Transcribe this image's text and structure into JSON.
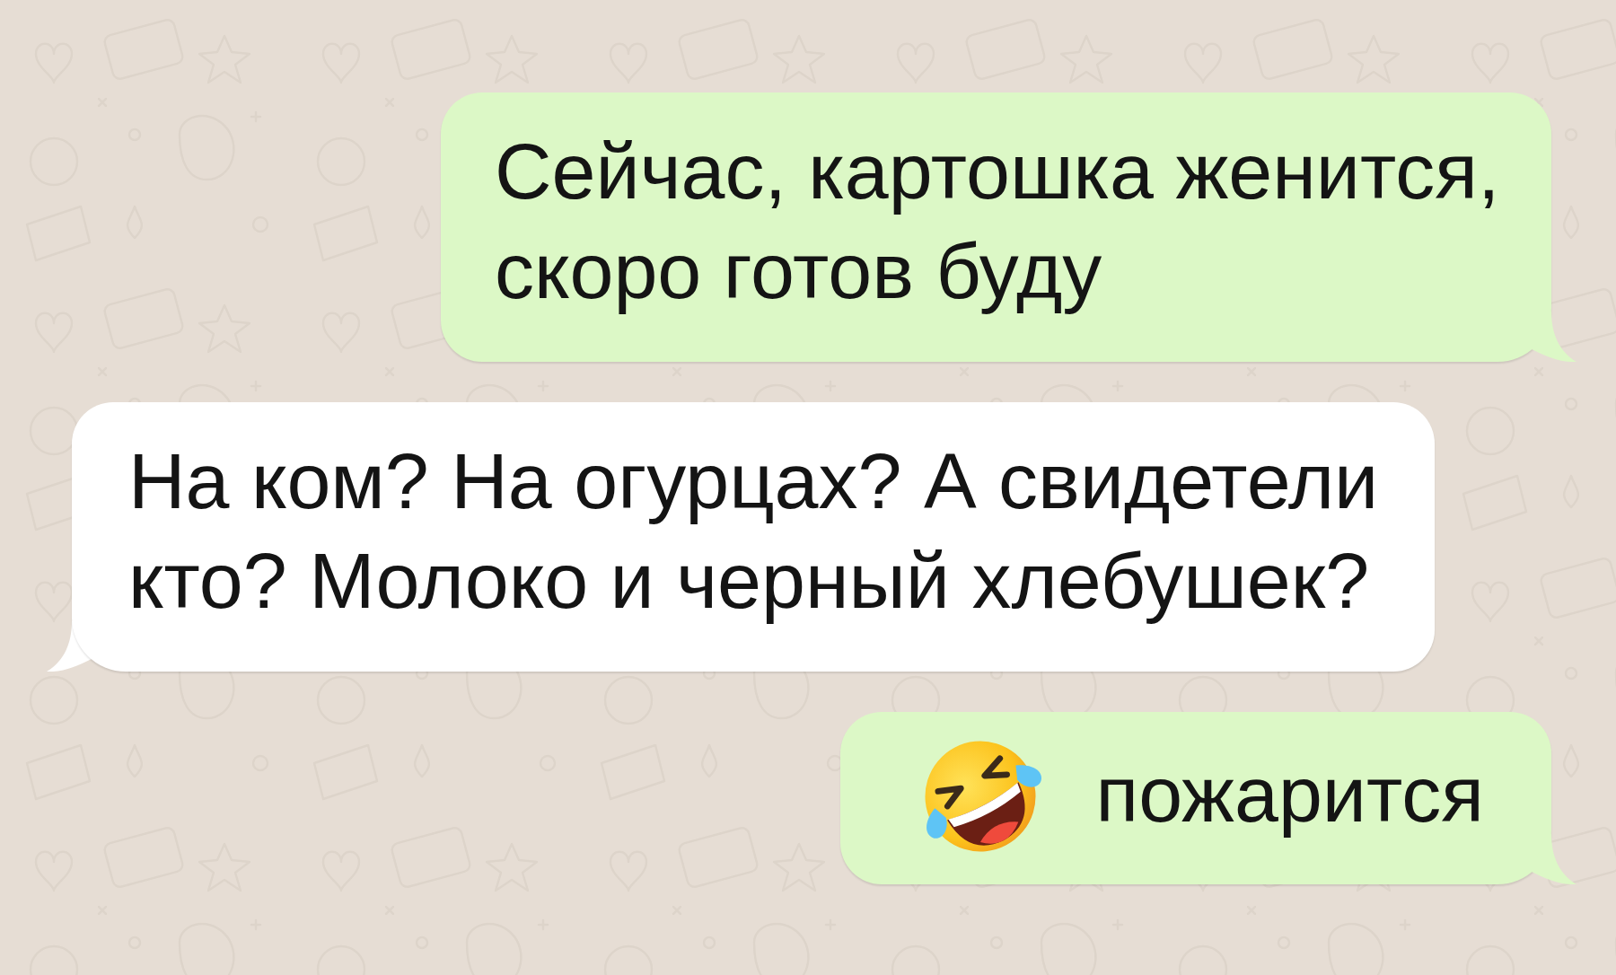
{
  "messages": [
    {
      "outgoing": true,
      "kind": "text",
      "text": "Сейчас, картошка женится, скоро готов буду"
    },
    {
      "outgoing": false,
      "kind": "text",
      "text": "На ком? На огурцах? А свидетели кто? Молоко и черный хлебушек?"
    },
    {
      "outgoing": true,
      "kind": "emoji_text",
      "text": "пожарится"
    }
  ]
}
